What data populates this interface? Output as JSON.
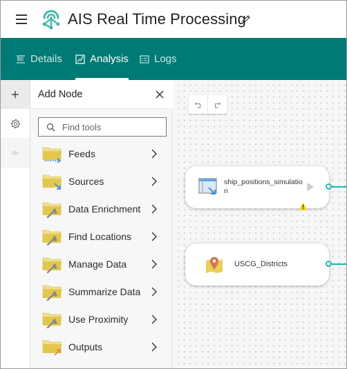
{
  "header": {
    "menu_icon": "hamburger-menu-icon",
    "logo_icon": "analytics-logo-icon",
    "title": "AIS Real Time Processing",
    "edit_icon": "pencil-icon"
  },
  "tabs": [
    {
      "label": "Details",
      "icon": "details-list-icon",
      "active": false
    },
    {
      "label": "Analysis",
      "icon": "analysis-diagram-icon",
      "active": true
    },
    {
      "label": "Logs",
      "icon": "logs-list-icon",
      "active": false
    }
  ],
  "rail": [
    {
      "name": "add-node",
      "icon": "plus-icon"
    },
    {
      "name": "settings",
      "icon": "gear-icon"
    },
    {
      "name": "monitor",
      "icon": "pulse-icon"
    }
  ],
  "panel": {
    "title": "Add Node",
    "close_icon": "close-icon",
    "search_placeholder": "Find tools",
    "search_value": "",
    "items": [
      {
        "label": "Feeds",
        "icon": "folder-feed-icon"
      },
      {
        "label": "Sources",
        "icon": "folder-source-icon"
      },
      {
        "label": "Data Enrichment",
        "icon": "folder-tool-icon"
      },
      {
        "label": "Find Locations",
        "icon": "folder-tool-icon"
      },
      {
        "label": "Manage Data",
        "icon": "folder-tool-icon"
      },
      {
        "label": "Summarize Data",
        "icon": "folder-tool-icon"
      },
      {
        "label": "Use Proximity",
        "icon": "folder-tool-icon"
      },
      {
        "label": "Outputs",
        "icon": "folder-output-icon"
      }
    ]
  },
  "canvas": {
    "undo_icon": "undo-icon",
    "redo_icon": "redo-icon",
    "nodes": [
      {
        "label": "ship_positions_simulation",
        "icon": "feed-window-icon",
        "has_warning": true,
        "warning_icon": "warning-icon"
      },
      {
        "label": "USCG_Districts",
        "icon": "map-pin-icon",
        "has_warning": false
      }
    ]
  },
  "colors": {
    "brand_teal": "#007a74",
    "port_cyan": "#19b7b6",
    "folder_yellow": "#e3c74d",
    "warning_yellow": "#f4d514"
  }
}
